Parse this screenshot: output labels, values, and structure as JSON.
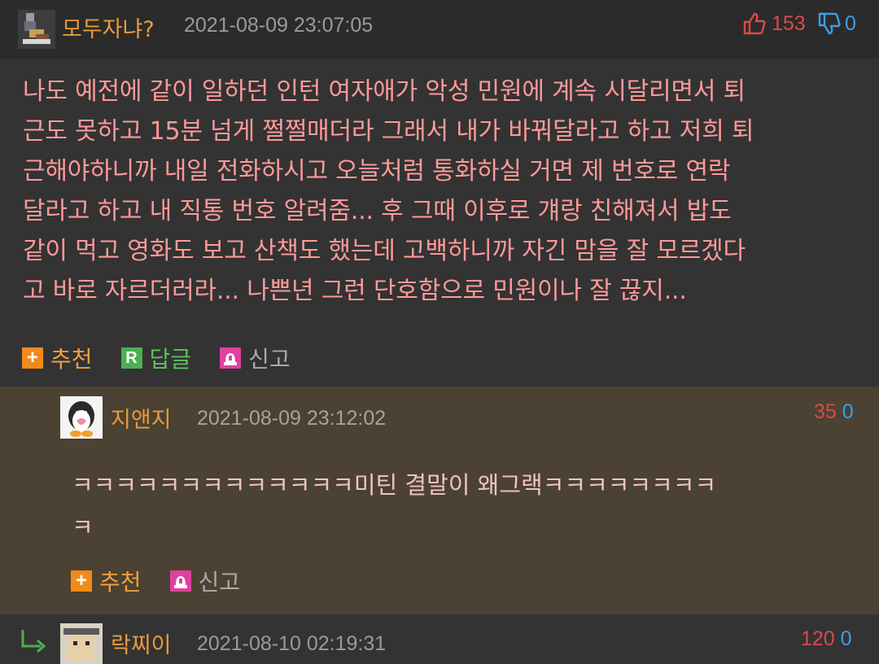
{
  "comments": [
    {
      "nickname": "모두자냐?",
      "date": "2021-08-09 23:07:05",
      "upvotes": "153",
      "downvotes": "0",
      "body": "나도 예전에 같이 일하던 인턴 여자애가 악성 민원에 계속 시달리면서 퇴\n근도 못하고 15분 넘게 쩔쩔매더라 그래서 내가 바꿔달라고 하고 저희 퇴\n근해야하니까 내일 전화하시고 오늘처럼 통화하실 거면 제 번호로 연락\n달라고 하고 내 직통 번호 알려줌... 후 그때 이후로 걔랑 친해져서 밥도\n같이 먹고 영화도 보고 산책도 했는데 고백하니까 자긴 맘을 잘 모르겠다\n고 바로 자르더러라... 나쁜년 그런 단호함으로 민원이나 잘 끊지...",
      "actions": {
        "recommend": "추천",
        "reply": "답글",
        "report": "신고"
      }
    },
    {
      "nickname": "지앤지",
      "date": "2021-08-09 23:12:02",
      "upvotes": "35",
      "downvotes": "0",
      "body": "ㅋㅋㅋㅋㅋㅋㅋㅋㅋㅋㅋㅋㅋ미틴 결말이 왜그랙ㅋㅋㅋㅋㅋㅋㅋㅋ\nㅋ",
      "actions": {
        "recommend": "추천",
        "report": "신고"
      }
    },
    {
      "nickname": "락찌이",
      "date": "2021-08-10 02:19:31",
      "upvotes": "120",
      "downvotes": "0"
    }
  ],
  "colors": {
    "nickname": "#e89b3a",
    "upvote": "#d94a4a",
    "downvote": "#3aa0e8",
    "body_text": "#ff9999",
    "reply_bg": "#4b4233"
  },
  "icons": {
    "recommend": "plus-icon",
    "reply": "reply-r-icon",
    "report": "siren-icon",
    "upvote": "thumbs-up-icon",
    "downvote": "thumbs-down-icon",
    "reply_arrow": "reply-arrow-icon"
  }
}
